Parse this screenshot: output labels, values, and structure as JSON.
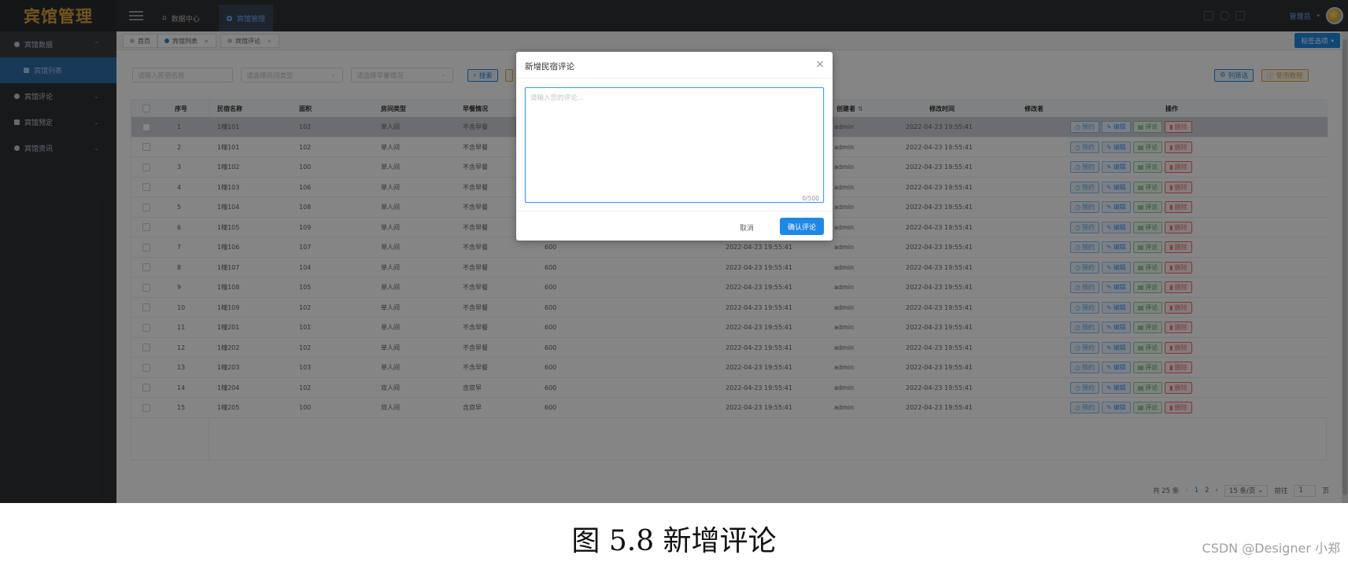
{
  "app": {
    "logo": "宾馆管理",
    "top_tabs": [
      {
        "label": "数据中心"
      },
      {
        "label": "宾馆管理"
      }
    ],
    "user_name": "管理员"
  },
  "sidebar": {
    "items": [
      {
        "label": "宾馆数据",
        "chevron": "⌃"
      },
      {
        "label": "宾馆列表"
      },
      {
        "label": "宾馆评论",
        "chevron": "⌄"
      },
      {
        "label": "宾馆预定",
        "chevron": "⌄"
      },
      {
        "label": "宾馆资讯",
        "chevron": "⌄"
      }
    ]
  },
  "tagsbar": {
    "tags": [
      {
        "label": "首页"
      },
      {
        "label": "宾馆列表",
        "close": "×"
      },
      {
        "label": "宾馆评论",
        "close": "×"
      }
    ],
    "options_label": "标签选项"
  },
  "filters": {
    "name_placeholder": "请输入民宿名称",
    "type_placeholder": "请选择房间类型",
    "breakfast_placeholder": "请选择早餐情况",
    "search_label": "搜索",
    "column_filter_label": "列筛选",
    "tutorial_label": "使用教程"
  },
  "table": {
    "headers": {
      "index": "序号",
      "name": "民宿名称",
      "area": "面积",
      "type": "房间类型",
      "breakfast": "早餐情况",
      "creator": "创建者",
      "updated": "修改时间",
      "modifier": "修改者",
      "actions": "操作"
    },
    "action_labels": {
      "reserve": "预约",
      "edit": "编辑",
      "review": "评论",
      "delete": "删除"
    },
    "rows": [
      {
        "index": "1",
        "name": "1幢101",
        "area": "102",
        "type": "单人间",
        "breakfast": "不含早餐",
        "price": "",
        "created": "",
        "creator": "admin",
        "updated": "2022-04-23 19:55:41"
      },
      {
        "index": "2",
        "name": "1幢101",
        "area": "102",
        "type": "单人间",
        "breakfast": "不含早餐",
        "price": "",
        "created": "",
        "creator": "admin",
        "updated": "2022-04-23 19:55:41"
      },
      {
        "index": "3",
        "name": "1幢102",
        "area": "100",
        "type": "单人间",
        "breakfast": "不含早餐",
        "price": "",
        "created": "",
        "creator": "admin",
        "updated": "2022-04-23 19:55:41"
      },
      {
        "index": "4",
        "name": "1幢103",
        "area": "106",
        "type": "单人间",
        "breakfast": "不含早餐",
        "price": "",
        "created": "",
        "creator": "admin",
        "updated": "2022-04-23 19:55:41"
      },
      {
        "index": "5",
        "name": "1幢104",
        "area": "108",
        "type": "单人间",
        "breakfast": "不含早餐",
        "price": "",
        "created": "",
        "creator": "admin",
        "updated": "2022-04-23 19:55:41"
      },
      {
        "index": "6",
        "name": "1幢105",
        "area": "109",
        "type": "单人间",
        "breakfast": "不含早餐",
        "price": "",
        "created": "",
        "creator": "admin",
        "updated": "2022-04-23 19:55:41"
      },
      {
        "index": "7",
        "name": "1幢106",
        "area": "107",
        "type": "单人间",
        "breakfast": "不含早餐",
        "price": "600",
        "created": "2022-04-23 19:55:41",
        "creator": "admin",
        "updated": "2022-04-23 19:55:41"
      },
      {
        "index": "8",
        "name": "1幢107",
        "area": "104",
        "type": "单人间",
        "breakfast": "不含早餐",
        "price": "600",
        "created": "2022-04-23 19:55:41",
        "creator": "admin",
        "updated": "2022-04-23 19:55:41"
      },
      {
        "index": "9",
        "name": "1幢108",
        "area": "105",
        "type": "单人间",
        "breakfast": "不含早餐",
        "price": "600",
        "created": "2022-04-23 19:55:41",
        "creator": "admin",
        "updated": "2022-04-23 19:55:41"
      },
      {
        "index": "10",
        "name": "1幢109",
        "area": "102",
        "type": "单人间",
        "breakfast": "不含早餐",
        "price": "600",
        "created": "2022-04-23 19:55:41",
        "creator": "admin",
        "updated": "2022-04-23 19:55:41"
      },
      {
        "index": "11",
        "name": "1幢201",
        "area": "101",
        "type": "单人间",
        "breakfast": "不含早餐",
        "price": "600",
        "created": "2022-04-23 19:55:41",
        "creator": "admin",
        "updated": "2022-04-23 19:55:41"
      },
      {
        "index": "12",
        "name": "1幢202",
        "area": "102",
        "type": "单人间",
        "breakfast": "不含早餐",
        "price": "600",
        "created": "2022-04-23 19:55:41",
        "creator": "admin",
        "updated": "2022-04-23 19:55:41"
      },
      {
        "index": "13",
        "name": "1幢203",
        "area": "103",
        "type": "单人间",
        "breakfast": "不含早餐",
        "price": "600",
        "created": "2022-04-23 19:55:41",
        "creator": "admin",
        "updated": "2022-04-23 19:55:41"
      },
      {
        "index": "14",
        "name": "1幢204",
        "area": "102",
        "type": "双人间",
        "breakfast": "含双早",
        "price": "600",
        "created": "2022-04-23 19:55:41",
        "creator": "admin",
        "updated": "2022-04-23 19:55:41"
      },
      {
        "index": "15",
        "name": "1幢205",
        "area": "100",
        "type": "双人间",
        "breakfast": "含双早",
        "price": "600",
        "created": "2022-04-23 19:55:41",
        "creator": "admin",
        "updated": "2022-04-23 19:55:41"
      }
    ]
  },
  "pager": {
    "total": "共 25 条",
    "prev": "‹",
    "pages": [
      "1",
      "2"
    ],
    "next": "›",
    "page_size": "15 条/页",
    "goto_label": "前往",
    "goto_value": "1",
    "page_unit": "页"
  },
  "dialog": {
    "title": "新增民宿评论",
    "close": "×",
    "placeholder": "请输入您的评论...",
    "counter": "0/500",
    "cancel_label": "取消",
    "confirm_label": "确认评论"
  },
  "caption": "图 5.8  新增评论",
  "watermark": "CSDN @Designer 小郑"
}
